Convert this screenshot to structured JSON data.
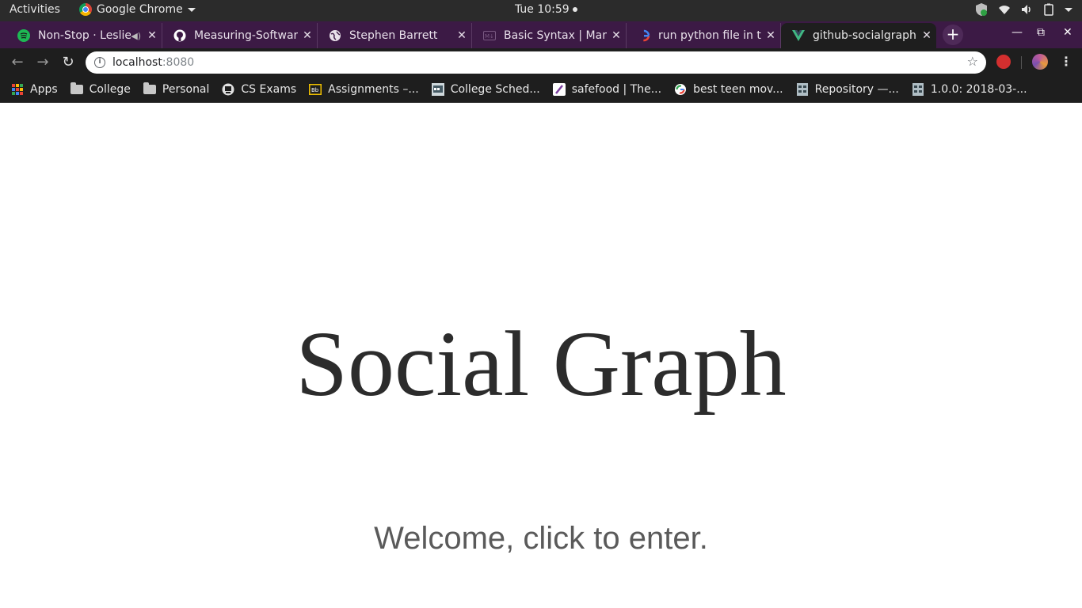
{
  "system_bar": {
    "activities": "Activities",
    "app_name": "Google Chrome",
    "clock": "Tue 10:59"
  },
  "tabs": [
    {
      "title": "Non-Stop · Leslie",
      "icon": "spotify-icon"
    },
    {
      "title": "Measuring-Softwar",
      "icon": "github-icon"
    },
    {
      "title": "Stephen Barrett",
      "icon": "globe-icon"
    },
    {
      "title": "Basic Syntax | Mark",
      "icon": "markdown-icon"
    },
    {
      "title": "run python file in te",
      "icon": "google-icon"
    },
    {
      "title": "github-socialgraph",
      "icon": "vue-icon",
      "active": true
    }
  ],
  "address_bar": {
    "host": "localhost",
    "port": ":8080"
  },
  "bookmarks": [
    {
      "label": "Apps",
      "icon": "apps-grid-icon"
    },
    {
      "label": "College",
      "icon": "folder-icon"
    },
    {
      "label": "Personal",
      "icon": "folder-icon"
    },
    {
      "label": "CS Exams",
      "icon": "exams-icon"
    },
    {
      "label": "Assignments –...",
      "icon": "blackboard-icon"
    },
    {
      "label": "College Sched...",
      "icon": "schedule-icon"
    },
    {
      "label": "safefood | The...",
      "icon": "safefood-icon"
    },
    {
      "label": "best teen mov...",
      "icon": "google-icon"
    },
    {
      "label": "Repository —...",
      "icon": "repository-icon"
    },
    {
      "label": "1.0.0: 2018-03-...",
      "icon": "document-icon"
    }
  ],
  "page": {
    "title": "Social Graph",
    "welcome": "Welcome, click to enter."
  },
  "colors": {
    "tab_strip": "#3c1a45",
    "toolbar": "#1e1e1e",
    "system_bar": "#2b2b2b",
    "title_text": "#2c2c2c",
    "welcome_text": "#5a5a5a"
  }
}
